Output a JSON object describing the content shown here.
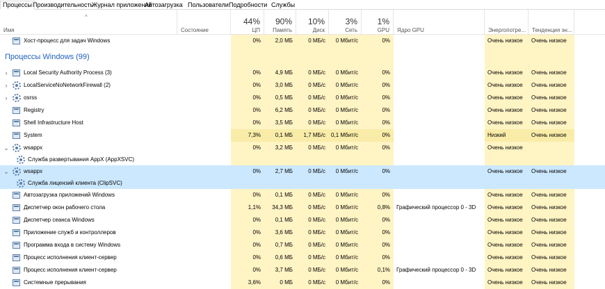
{
  "tabs": [
    "Процессы",
    "Производительность",
    "Журнал приложений",
    "Автозагрузка",
    "Пользователи",
    "Подробности",
    "Службы"
  ],
  "columns": {
    "name": "Имя",
    "status": "Состояние",
    "cpu": {
      "pct": "44%",
      "label": "ЦП"
    },
    "mem": {
      "pct": "90%",
      "label": "Память"
    },
    "disk": {
      "pct": "10%",
      "label": "Диск"
    },
    "net": {
      "pct": "3%",
      "label": "Сеть"
    },
    "gpu": {
      "pct": "1%",
      "label": "GPU"
    },
    "gpu_engine": "Ядро GPU",
    "power": "Энергопотре...",
    "power_trend": "Тенденция эн..."
  },
  "rows": [
    {
      "kind": "proc",
      "icon": "window",
      "name": "Хост-процесс для задач Windows",
      "cpu": "0%",
      "mem": "2,0 МБ",
      "disk": "0 МБ/с",
      "net": "0 Мбит/с",
      "gpu": "0%",
      "engine": "",
      "power": "Очень низкое",
      "trend": "Очень низкое"
    },
    {
      "kind": "group",
      "name": "Процессы Windows (99)"
    },
    {
      "kind": "proc",
      "exp": "›",
      "icon": "window",
      "name": "Local Security Authority Process (3)",
      "cpu": "0%",
      "mem": "4,9 МБ",
      "disk": "0 МБ/с",
      "net": "0 Мбит/с",
      "gpu": "0%",
      "engine": "",
      "power": "Очень низкое",
      "trend": "Очень низкое"
    },
    {
      "kind": "proc",
      "exp": "›",
      "icon": "gear",
      "name": "LocalServiceNoNetworkFirewall (2)",
      "cpu": "0%",
      "mem": "3,0 МБ",
      "disk": "0 МБ/с",
      "net": "0 Мбит/с",
      "gpu": "0%",
      "engine": "",
      "power": "Очень низкое",
      "trend": "Очень низкое"
    },
    {
      "kind": "proc",
      "exp": "›",
      "icon": "gear",
      "name": "osrss",
      "cpu": "0%",
      "mem": "0,5 МБ",
      "disk": "0 МБ/с",
      "net": "0 Мбит/с",
      "gpu": "0%",
      "engine": "",
      "power": "Очень низкое",
      "trend": "Очень низкое"
    },
    {
      "kind": "proc",
      "icon": "window",
      "name": "Registry",
      "cpu": "0%",
      "mem": "6,2 МБ",
      "disk": "0 МБ/с",
      "net": "0 Мбит/с",
      "gpu": "0%",
      "engine": "",
      "power": "Очень низкое",
      "trend": "Очень низкое"
    },
    {
      "kind": "proc",
      "icon": "window",
      "name": "Shell Infrastructure Host",
      "cpu": "0%",
      "mem": "3,5 МБ",
      "disk": "0 МБ/с",
      "net": "0 Мбит/с",
      "gpu": "0%",
      "engine": "",
      "power": "Очень низкое",
      "trend": "Очень низкое"
    },
    {
      "kind": "proc",
      "icon": "window",
      "name": "System",
      "cpu": "7,3%",
      "mem": "0,1 МБ",
      "disk": "1,7 МБ/с",
      "net": "0,1 Мбит/с",
      "gpu": "0%",
      "engine": "",
      "power": "Низкий",
      "trend": "Очень низкое",
      "dark": true
    },
    {
      "kind": "proc",
      "exp": "⌄",
      "icon": "gear",
      "name": "wsappx",
      "cpu": "0%",
      "mem": "3,2 МБ",
      "disk": "0 МБ/с",
      "net": "0 Мбит/с",
      "gpu": "0%",
      "engine": "",
      "power": "Очень низкое",
      "trend": ""
    },
    {
      "kind": "child",
      "icon": "gear",
      "name": "Служба развертывания AppX (AppXSVC)"
    },
    {
      "kind": "proc",
      "sel": true,
      "exp": "⌄",
      "icon": "gear",
      "name": "wsappx",
      "cpu": "0%",
      "mem": "2,7 МБ",
      "disk": "0 МБ/с",
      "net": "0 Мбит/с",
      "gpu": "0%",
      "engine": "",
      "power": "Очень низкое",
      "trend": "Очень низкое"
    },
    {
      "kind": "child",
      "sel": true,
      "icon": "gear",
      "name": "Служба лицензий клиента (ClipSVC)"
    },
    {
      "kind": "proc",
      "icon": "window",
      "name": "Автозагрузка приложений Windows",
      "cpu": "0%",
      "mem": "0,1 МБ",
      "disk": "0 МБ/с",
      "net": "0 Мбит/с",
      "gpu": "0%",
      "engine": "",
      "power": "Очень низкое",
      "trend": "Очень низкое"
    },
    {
      "kind": "proc",
      "icon": "window",
      "name": "Диспетчер окон рабочего стола",
      "cpu": "1,1%",
      "mem": "34,3 МБ",
      "disk": "0 МБ/с",
      "net": "0 Мбит/с",
      "gpu": "0,8%",
      "engine": "Графический процессор 0 - 3D",
      "power": "Очень низкое",
      "trend": "Очень низкое"
    },
    {
      "kind": "proc",
      "icon": "window",
      "name": "Диспетчер сеанса  Windows",
      "cpu": "0%",
      "mem": "0,1 МБ",
      "disk": "0 МБ/с",
      "net": "0 Мбит/с",
      "gpu": "0%",
      "engine": "",
      "power": "Очень низкое",
      "trend": "Очень низкое"
    },
    {
      "kind": "proc",
      "icon": "window",
      "name": "Приложение служб и контроллеров",
      "cpu": "0%",
      "mem": "3,6 МБ",
      "disk": "0 МБ/с",
      "net": "0 Мбит/с",
      "gpu": "0%",
      "engine": "",
      "power": "Очень низкое",
      "trend": "Очень низкое"
    },
    {
      "kind": "proc",
      "icon": "window",
      "name": "Программа входа в систему Windows",
      "cpu": "0%",
      "mem": "0,7 МБ",
      "disk": "0 МБ/с",
      "net": "0 Мбит/с",
      "gpu": "0%",
      "engine": "",
      "power": "Очень низкое",
      "trend": "Очень низкое"
    },
    {
      "kind": "proc",
      "icon": "window",
      "name": "Процесс исполнения клиент-сервер",
      "cpu": "0%",
      "mem": "0,6 МБ",
      "disk": "0 МБ/с",
      "net": "0 Мбит/с",
      "gpu": "0%",
      "engine": "",
      "power": "Очень низкое",
      "trend": "Очень низкое"
    },
    {
      "kind": "proc",
      "icon": "window",
      "name": "Процесс исполнения клиент-сервер",
      "cpu": "0%",
      "mem": "3,7 МБ",
      "disk": "0 МБ/с",
      "net": "0 Мбит/с",
      "gpu": "0,1%",
      "engine": "Графический процессор 0 - 3D",
      "power": "Очень низкое",
      "trend": "Очень низкое"
    },
    {
      "kind": "proc",
      "icon": "window",
      "name": "Системные прерывания",
      "cpu": "3,6%",
      "mem": "0 МБ",
      "disk": "0 МБ/с",
      "net": "0 Мбит/с",
      "gpu": "0%",
      "engine": "",
      "power": "Очень низкое",
      "trend": "Очень низкое"
    }
  ]
}
